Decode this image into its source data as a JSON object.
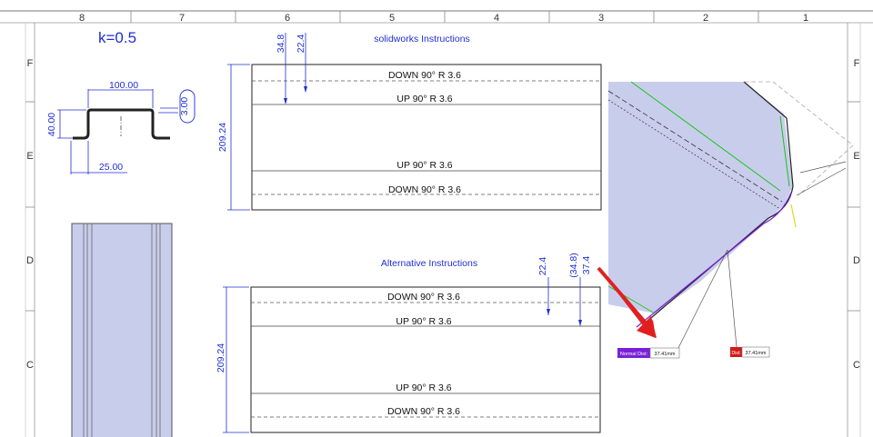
{
  "zones": {
    "cols": [
      "8",
      "7",
      "6",
      "5",
      "4",
      "3",
      "2",
      "1"
    ],
    "rows_left": [
      "F",
      "E",
      "D",
      "C"
    ],
    "rows_right": [
      "F",
      "E",
      "D",
      "C"
    ]
  },
  "k_factor": "k=0.5",
  "profile_dims": {
    "top_width": "100.00",
    "height": "40.00",
    "thickness": "3.00",
    "flange": "25.00"
  },
  "solidworks": {
    "title": "solidworks Instructions",
    "width_dim": "209.24",
    "offset_a": "34.8",
    "offset_b": "22.4",
    "bends": [
      "DOWN  90°  R 3.6",
      "UP  90°  R 3.6",
      "UP  90°  R 3.6",
      "DOWN  90°  R 3.6"
    ]
  },
  "alternative": {
    "title": "Alternative Instructions",
    "width_dim": "209.24",
    "offset_a": "22.4",
    "offset_b": "(34.8)",
    "offset_c": "37.4",
    "bends": [
      "DOWN  90°  R 3.6",
      "UP  90°  R 3.6",
      "UP  90°  R 3.6",
      "DOWN  90°  R 3.6"
    ]
  },
  "measurements": {
    "normal_label": "Normal Dist:",
    "normal_value": "37.41mm",
    "red_label": "Dist:",
    "red_value": "37.41mm"
  },
  "colors": {
    "dimension": "#1f2fd0",
    "part_fill": "#c9cdec",
    "arrow": "#e02020",
    "badge_purple": "#7a1fd6",
    "badge_red": "#d21a1a",
    "edge_green": "#19c419",
    "edge_yellow": "#e8d21a"
  }
}
